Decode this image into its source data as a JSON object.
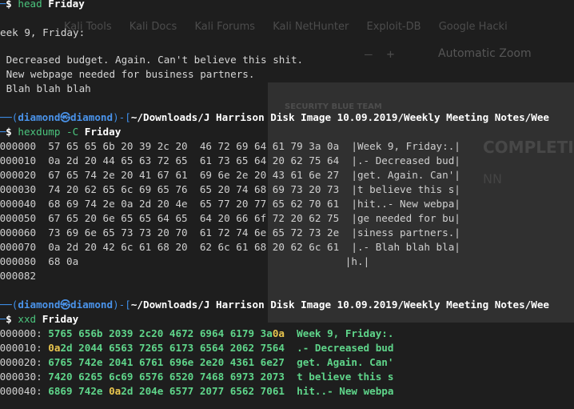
{
  "background_window": {
    "bookmarks": [
      "Kali Tools",
      "Kali Docs",
      "Kali Forums",
      "Kali NetHunter",
      "Exploit-DB",
      "Google Hacki"
    ],
    "zoom_label": "Automatic Zoom",
    "doc_header": "SECURITY BLUE TEAM",
    "doc_title": "COMPLETION",
    "doc_name": "NN"
  },
  "prompt": {
    "user": "diamond",
    "at": "㉿",
    "host": "diamond",
    "path": "~/Downloads/J Harrison Disk Image 10.09.2019/Weekly Meeting Notes/Wee",
    "symbol": "$"
  },
  "block1": {
    "command": "head",
    "argument": "Friday",
    "output": [
      "eek 9, Friday:",
      "",
      " Decreased budget. Again. Can't believe this shit.",
      " New webpage needed for business partners.",
      " Blah blah blah"
    ]
  },
  "block2": {
    "command": "hexdump",
    "flag": "-C",
    "argument": "Friday",
    "rows": [
      {
        "offset": "0000000",
        "hex1": "57 65 65 6b 20 39 2c 20",
        "hex2": "46 72 69 64 61 79 3a 0a",
        "ascii": "Week 9, Friday:."
      },
      {
        "offset": "0000010",
        "hex1": "0a 2d 20 44 65 63 72 65",
        "hex2": "61 73 65 64 20 62 75 64",
        "ascii": ".- Decreased bud"
      },
      {
        "offset": "0000020",
        "hex1": "67 65 74 2e 20 41 67 61",
        "hex2": "69 6e 2e 20 43 61 6e 27",
        "ascii": "get. Again. Can'"
      },
      {
        "offset": "0000030",
        "hex1": "74 20 62 65 6c 69 65 76",
        "hex2": "65 20 74 68 69 73 20 73",
        "ascii": "t believe this s"
      },
      {
        "offset": "0000040",
        "hex1": "68 69 74 2e 0a 2d 20 4e",
        "hex2": "65 77 20 77 65 62 70 61",
        "ascii": "hit..- New webpa"
      },
      {
        "offset": "0000050",
        "hex1": "67 65 20 6e 65 65 64 65",
        "hex2": "64 20 66 6f 72 20 62 75",
        "ascii": "ge needed for bu"
      },
      {
        "offset": "0000060",
        "hex1": "73 69 6e 65 73 73 20 70",
        "hex2": "61 72 74 6e 65 72 73 2e",
        "ascii": "siness partners."
      },
      {
        "offset": "0000070",
        "hex1": "0a 2d 20 42 6c 61 68 20",
        "hex2": "62 6c 61 68 20 62 6c 61",
        "ascii": ".- Blah blah bla"
      },
      {
        "offset": "0000080",
        "hex1": "68 0a",
        "hex2": "",
        "ascii": "h.",
        "ascii_tail": "|"
      },
      {
        "offset": "0000082"
      }
    ]
  },
  "block3": {
    "command": "xxd",
    "argument": "Friday",
    "rows": [
      {
        "offset": "0000000:",
        "pre": "5765 656b 2039 2c20 4672 6964 6179 3a",
        "hl": "0a",
        "post": "",
        "text": "Week 9, Friday:."
      },
      {
        "offset": "0000010:",
        "pre": "",
        "hl": "0a",
        "post": "2d 2044 6563 7265 6173 6564 2062 7564",
        "text": ".- Decreased bud"
      },
      {
        "offset": "0000020:",
        "pre": "6765 742e 2041 6761 696e 2e20 4361 6e27",
        "hl": "",
        "post": "",
        "text": "get. Again. Can'"
      },
      {
        "offset": "0000030:",
        "pre": "7420 6265 6c69 6576 6520 7468 6973 2073",
        "hl": "",
        "post": "",
        "text": "t believe this s"
      },
      {
        "offset": "0000040:",
        "pre": "6869 742e ",
        "hl": "0a",
        "post": "2d 204e 6577 2077 6562 7061",
        "text": "hit..- New webpa"
      }
    ]
  }
}
